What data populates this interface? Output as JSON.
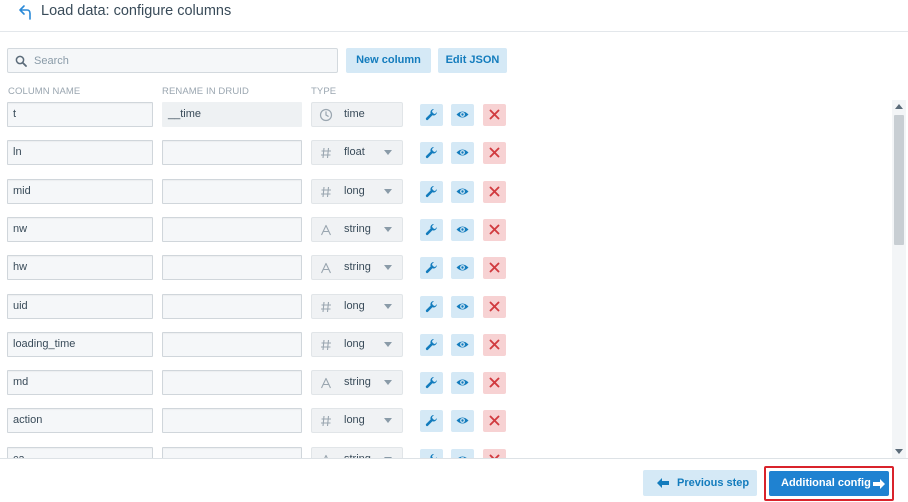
{
  "header": {
    "title": "Load data: configure columns",
    "back_icon": "undo-arrow-icon"
  },
  "toolbar": {
    "search_placeholder": "Search",
    "new_column_label": "New column",
    "edit_json_label": "Edit JSON"
  },
  "columns_header": {
    "column_name": "COLUMN NAME",
    "rename_in_druid": "RENAME IN DRUID",
    "type": "TYPE"
  },
  "rows": [
    {
      "name": "t",
      "rename": "__time",
      "type": "time",
      "type_icon": "clock-icon"
    },
    {
      "name": "ln",
      "rename": "",
      "type": "float",
      "type_icon": "hash-icon"
    },
    {
      "name": "mid",
      "rename": "",
      "type": "long",
      "type_icon": "hash-icon"
    },
    {
      "name": "nw",
      "rename": "",
      "type": "string",
      "type_icon": "string-icon"
    },
    {
      "name": "hw",
      "rename": "",
      "type": "string",
      "type_icon": "string-icon"
    },
    {
      "name": "uid",
      "rename": "",
      "type": "long",
      "type_icon": "hash-icon"
    },
    {
      "name": "loading_time",
      "rename": "",
      "type": "long",
      "type_icon": "hash-icon"
    },
    {
      "name": "md",
      "rename": "",
      "type": "string",
      "type_icon": "string-icon"
    },
    {
      "name": "action",
      "rename": "",
      "type": "long",
      "type_icon": "hash-icon"
    },
    {
      "name": "ca",
      "rename": "",
      "type": "string",
      "type_icon": "string-icon"
    }
  ],
  "footer": {
    "previous_label": "Previous step",
    "next_label": "Additional config"
  },
  "colors": {
    "accent": "#137cbd",
    "primary_button": "#1f82d1",
    "light_button": "#d5e9f6",
    "danger_light": "#f7d2d3",
    "highlight_border": "#d9232b"
  }
}
